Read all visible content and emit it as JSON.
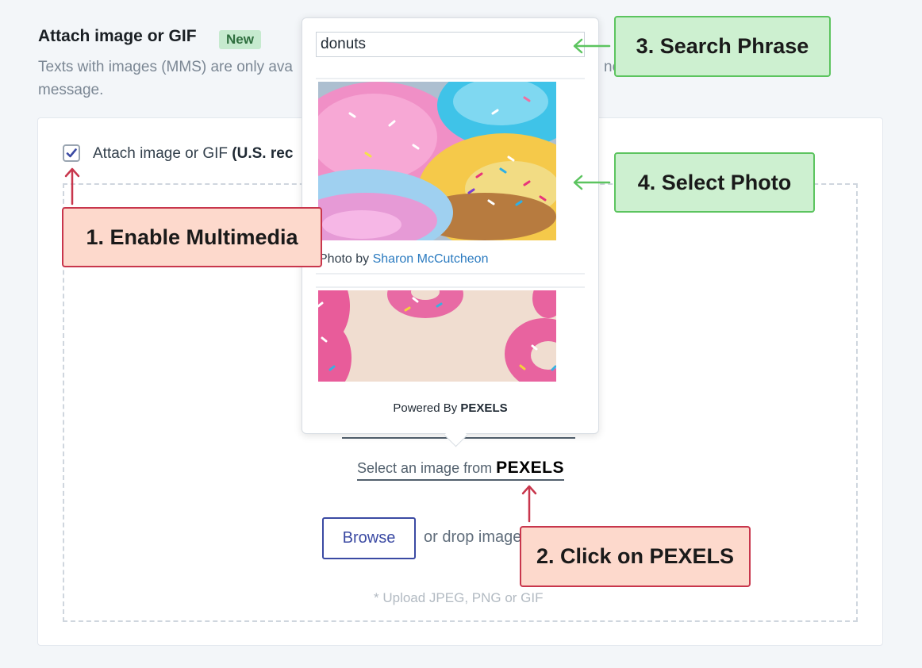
{
  "header": {
    "title": "Attach image or GIF",
    "badge": "New",
    "description_line1": "Texts with images (MMS) are only ava",
    "description_tail": "ne",
    "description_line2": "message."
  },
  "attach": {
    "checked": true,
    "label": "Attach image or GIF",
    "label_bold": "(U.S. rec"
  },
  "popover": {
    "search_value": "donuts",
    "credit_prefix": "Photo by",
    "credit_name": "Sharon McCutcheon",
    "powered_prefix": "Powered By",
    "powered_brand": "PEXELS"
  },
  "uploader": {
    "pexels_prefix": "Select an image from",
    "pexels_brand": "PEXELS",
    "browse_label": "Browse",
    "drop_text": "or drop image",
    "hint": "* Upload JPEG, PNG or GIF"
  },
  "callouts": {
    "step1": "1. Enable Multimedia",
    "step2": "2. Click on PEXELS",
    "step3": "3. Search Phrase",
    "step4": "4. Select Photo"
  },
  "colors": {
    "red_callout_border": "#c8364c",
    "green_callout_border": "#5cc45f",
    "link": "#2b7bc0",
    "button": "#3b4aa3"
  }
}
